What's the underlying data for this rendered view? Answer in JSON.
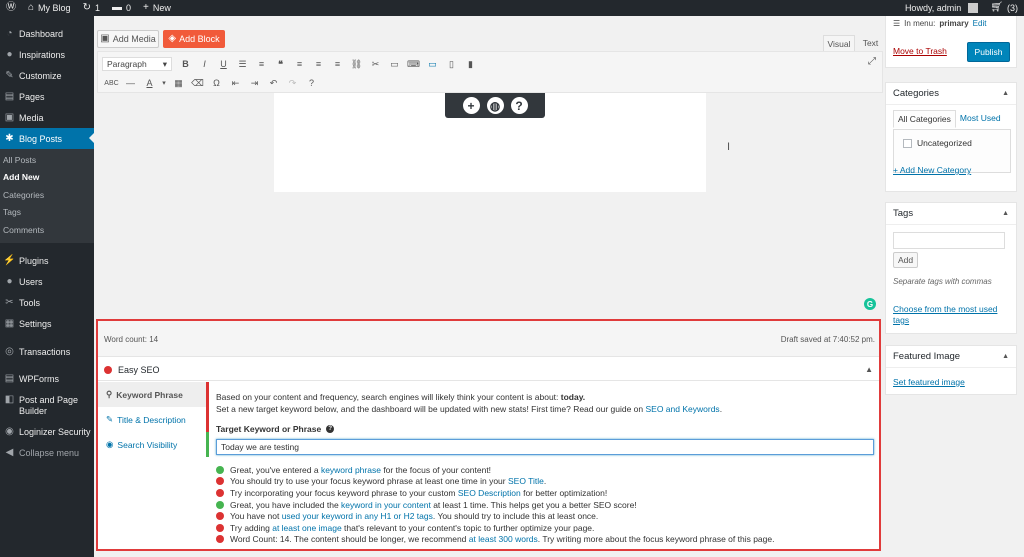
{
  "adminbar": {
    "site": "My Blog",
    "updates": "1",
    "comments": "0",
    "new": "New",
    "howdy": "Howdy, admin",
    "cart": "(3)"
  },
  "sidebar": {
    "items": [
      {
        "label": "Dashboard",
        "icon": "dashboard-icon",
        "glyph": "◔"
      },
      {
        "label": "Inspirations",
        "icon": "lightbulb-icon",
        "glyph": "●"
      },
      {
        "label": "Customize",
        "icon": "brush-icon",
        "glyph": "✎"
      },
      {
        "label": "Pages",
        "icon": "pages-icon",
        "glyph": "▤"
      },
      {
        "label": "Media",
        "icon": "media-icon",
        "glyph": "▣"
      },
      {
        "label": "Blog Posts",
        "icon": "pin-icon",
        "glyph": "✱"
      }
    ],
    "submenu": [
      "All Posts",
      "Add New",
      "Categories",
      "Tags",
      "Comments"
    ],
    "items2": [
      {
        "label": "Plugins",
        "icon": "plugin-icon",
        "glyph": "⚡"
      },
      {
        "label": "Users",
        "icon": "users-icon",
        "glyph": "●"
      },
      {
        "label": "Tools",
        "icon": "tools-icon",
        "glyph": "✂"
      },
      {
        "label": "Settings",
        "icon": "settings-icon",
        "glyph": "▦"
      }
    ],
    "transactions": {
      "label": "Transactions",
      "icon": "transactions-icon",
      "glyph": "◎"
    },
    "wpforms": {
      "label": "WPForms",
      "icon": "forms-icon",
      "glyph": "▤"
    },
    "postpage": {
      "line1": "Post and Page",
      "line2": "Builder",
      "icon": "builder-icon",
      "glyph": "◧"
    },
    "loginizer": {
      "label": "Loginizer Security",
      "icon": "shield-icon",
      "glyph": "◉"
    },
    "collapse": {
      "label": "Collapse menu",
      "icon": "collapse-icon",
      "glyph": "◀"
    }
  },
  "editor": {
    "add_media": "Add Media",
    "add_block": "Add Block",
    "tab_visual": "Visual",
    "tab_text": "Text",
    "format_select": "Paragraph"
  },
  "status": {
    "word_count": "Word count: 14",
    "draft_saved": "Draft saved at 7:40:52 pm."
  },
  "seo": {
    "title": "Easy SEO",
    "nav": [
      "Keyword Phrase",
      "Title & Description",
      "Search Visibility"
    ],
    "intro_1": "Based on your content and frequency, search engines will likely think your content is about: ",
    "intro_topic": "today.",
    "intro_2": "Set a new target keyword below, and the dashboard will be updated with new stats! First time? Read our guide on ",
    "intro_link": "SEO and Keywords",
    "intro_end": ".",
    "kw_label": "Target Keyword or Phrase",
    "kw_value": "Today we are testing",
    "checks": [
      {
        "status": "green",
        "pre": "Great, you've entered a ",
        "link": "keyword phrase",
        "post": " for the focus of your content!"
      },
      {
        "status": "red",
        "pre": "You should try to use your focus keyword phrase at least one time in your ",
        "link": "SEO Title",
        "post": "."
      },
      {
        "status": "red",
        "pre": "Try incorporating your focus keyword phrase to your custom ",
        "link": "SEO Description",
        "post": " for better optimization!"
      },
      {
        "status": "green",
        "pre": "Great, you have included the ",
        "link": "keyword in your content",
        "post": " at least 1 time. This helps get you a better SEO score!"
      },
      {
        "status": "red",
        "pre": "You have not ",
        "link": "used your keyword in any H1 or H2 tags",
        "post": ". You should try to include this at least once."
      },
      {
        "status": "red",
        "pre": "Try adding ",
        "link": "at least one image",
        "post": " that's relevant to your content's topic to further optimize your page."
      },
      {
        "status": "red",
        "pre": "Word Count: 14. The content should be longer, we recommend ",
        "link": "at least 300 words",
        "post": ". Try writing more about the focus keyword phrase of this page."
      }
    ]
  },
  "publish": {
    "in_menu": "In menu:",
    "menu_name": "primary",
    "edit": "Edit",
    "trash": "Move to Trash",
    "publish": "Publish"
  },
  "categories": {
    "title": "Categories",
    "tab_all": "All Categories",
    "tab_most": "Most Used",
    "item": "Uncategorized",
    "add": "+ Add New Category"
  },
  "tags": {
    "title": "Tags",
    "add": "Add",
    "hint": "Separate tags with commas",
    "most_used": "Choose from the most used tags"
  },
  "featured": {
    "title": "Featured Image",
    "link": "Set featured image"
  },
  "colors": {
    "admin_bar": "#23282d",
    "accent": "#0073aa",
    "add_block": "#f15a3a",
    "highlight": "#e03b3b",
    "good": "#46b450",
    "bad": "#dc3232"
  }
}
